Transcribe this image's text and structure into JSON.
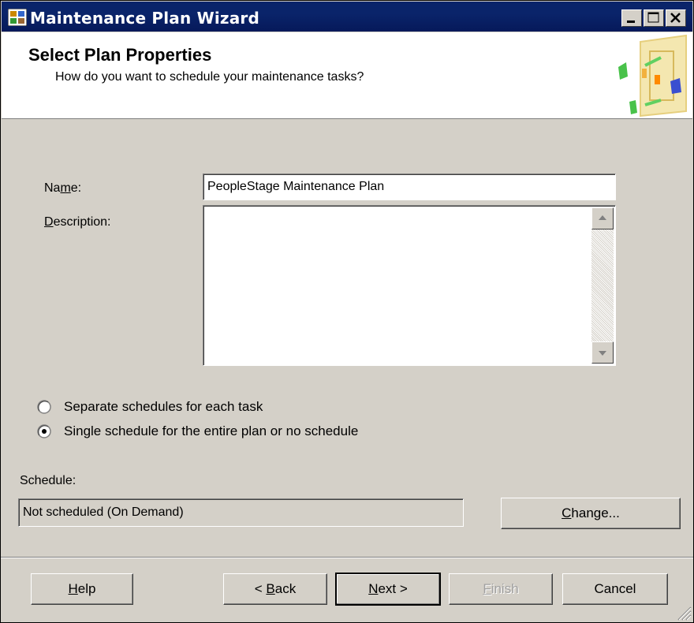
{
  "window": {
    "title": "Maintenance Plan Wizard",
    "controls": [
      "minimize-icon",
      "maximize-icon",
      "close-icon"
    ]
  },
  "header": {
    "title": "Select Plan Properties",
    "subtitle": "How do you want to schedule your maintenance tasks?"
  },
  "form": {
    "name_label_pre": "Na",
    "name_label_accel": "m",
    "name_label_post": "e:",
    "name_value": "PeopleStage Maintenance Plan",
    "description_label_accel": "D",
    "description_label_post": "escription:",
    "description_value": ""
  },
  "schedule_options": [
    {
      "label": "Separate schedules for each task",
      "selected": false
    },
    {
      "label": "Single schedule for the entire plan or no schedule",
      "selected": true
    }
  ],
  "schedule": {
    "label": "Schedule:",
    "value": "Not scheduled (On Demand)",
    "change_accel": "C",
    "change_post": "hange..."
  },
  "buttons": {
    "help_accel": "H",
    "help_post": "elp",
    "back_pre": "< ",
    "back_accel": "B",
    "back_post": "ack",
    "next_accel": "N",
    "next_post": "ext >",
    "finish_accel": "F",
    "finish_post": "inish",
    "cancel": "Cancel"
  },
  "colors": {
    "titlebar": "#0a246a",
    "face": "#d4d0c8",
    "disabled_text": "#a0a0a0"
  }
}
